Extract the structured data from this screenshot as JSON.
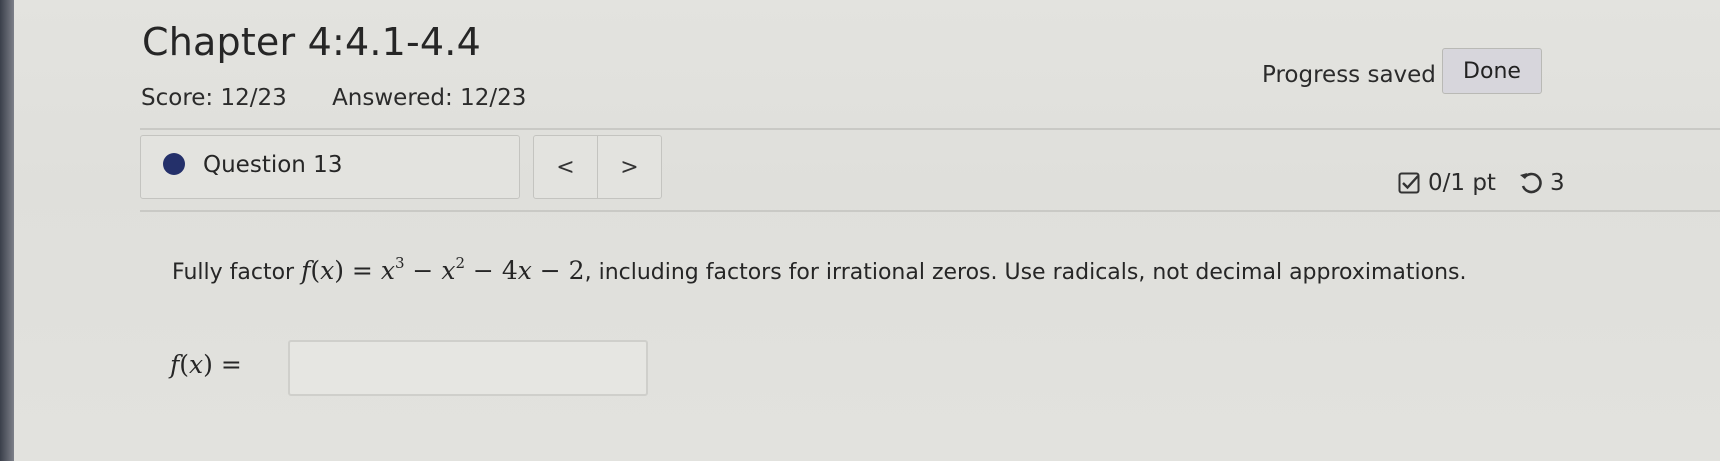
{
  "header": {
    "title": "Chapter 4:4.1-4.4",
    "score": "Score: 12/23",
    "answered": "Answered: 12/23",
    "progress_status": "Progress saved",
    "done_label": "Done"
  },
  "question_nav": {
    "selected_question": "Question 13",
    "prev_label": "<",
    "next_label": ">"
  },
  "question_meta": {
    "points": "0/1 pt",
    "retries": "3"
  },
  "question": {
    "text_before": "Fully factor ",
    "text_after": ", including factors for irrational zeros. Use radicals, not decimal approximations."
  },
  "answer": {
    "value": "",
    "placeholder": ""
  },
  "colors": {
    "current_question_dot": "#24306a",
    "background": "#dfdfdb"
  }
}
